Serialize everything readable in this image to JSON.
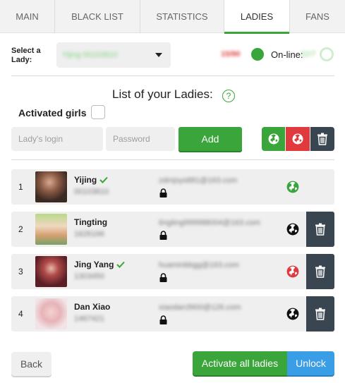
{
  "tabs": [
    {
      "label": "MAIN",
      "active": false
    },
    {
      "label": "BLACK LIST",
      "active": false
    },
    {
      "label": "STATISTICS",
      "active": false
    },
    {
      "label": "LADIES",
      "active": true
    },
    {
      "label": "FANS",
      "active": false
    }
  ],
  "select_lady": {
    "label_line1": "Select a",
    "label_line2": "Lady:",
    "value": "Yijing 00103810"
  },
  "status": {
    "count": "15/90",
    "online_label": "On-line:",
    "online_value": "22/7"
  },
  "list_title": "List of your Ladies:",
  "activated_girls_label": "Activated girls",
  "form": {
    "login_placeholder": "Lady's login",
    "password_placeholder": "Password",
    "add_label": "Add"
  },
  "ladies": [
    {
      "num": "1",
      "name": "Yijing",
      "verified": true,
      "id": "00103810",
      "email": "zdmjsys881@163.com",
      "globe": "green",
      "deletable": false
    },
    {
      "num": "2",
      "name": "Tingting",
      "verified": false,
      "id": "1626166",
      "email": "tingting999988004@163.com",
      "globe": "dark",
      "deletable": true
    },
    {
      "num": "3",
      "name": "Jing Yang",
      "verified": true,
      "id": "1303450",
      "email": "huaminbbgg@163.com",
      "globe": "red",
      "deletable": true
    },
    {
      "num": "4",
      "name": "Dan Xiao",
      "verified": false,
      "id": "1467421",
      "email": "xiaodan3900@126.com",
      "globe": "dark",
      "deletable": true
    }
  ],
  "buttons": {
    "back": "Back",
    "activate_all": "Activate all ladies",
    "unlock": "Unlock"
  },
  "colors": {
    "accent_green": "#3aa53a",
    "danger_red": "#e0393e",
    "dark_slate": "#3a4552",
    "unlock_blue": "#3a9ee6"
  }
}
